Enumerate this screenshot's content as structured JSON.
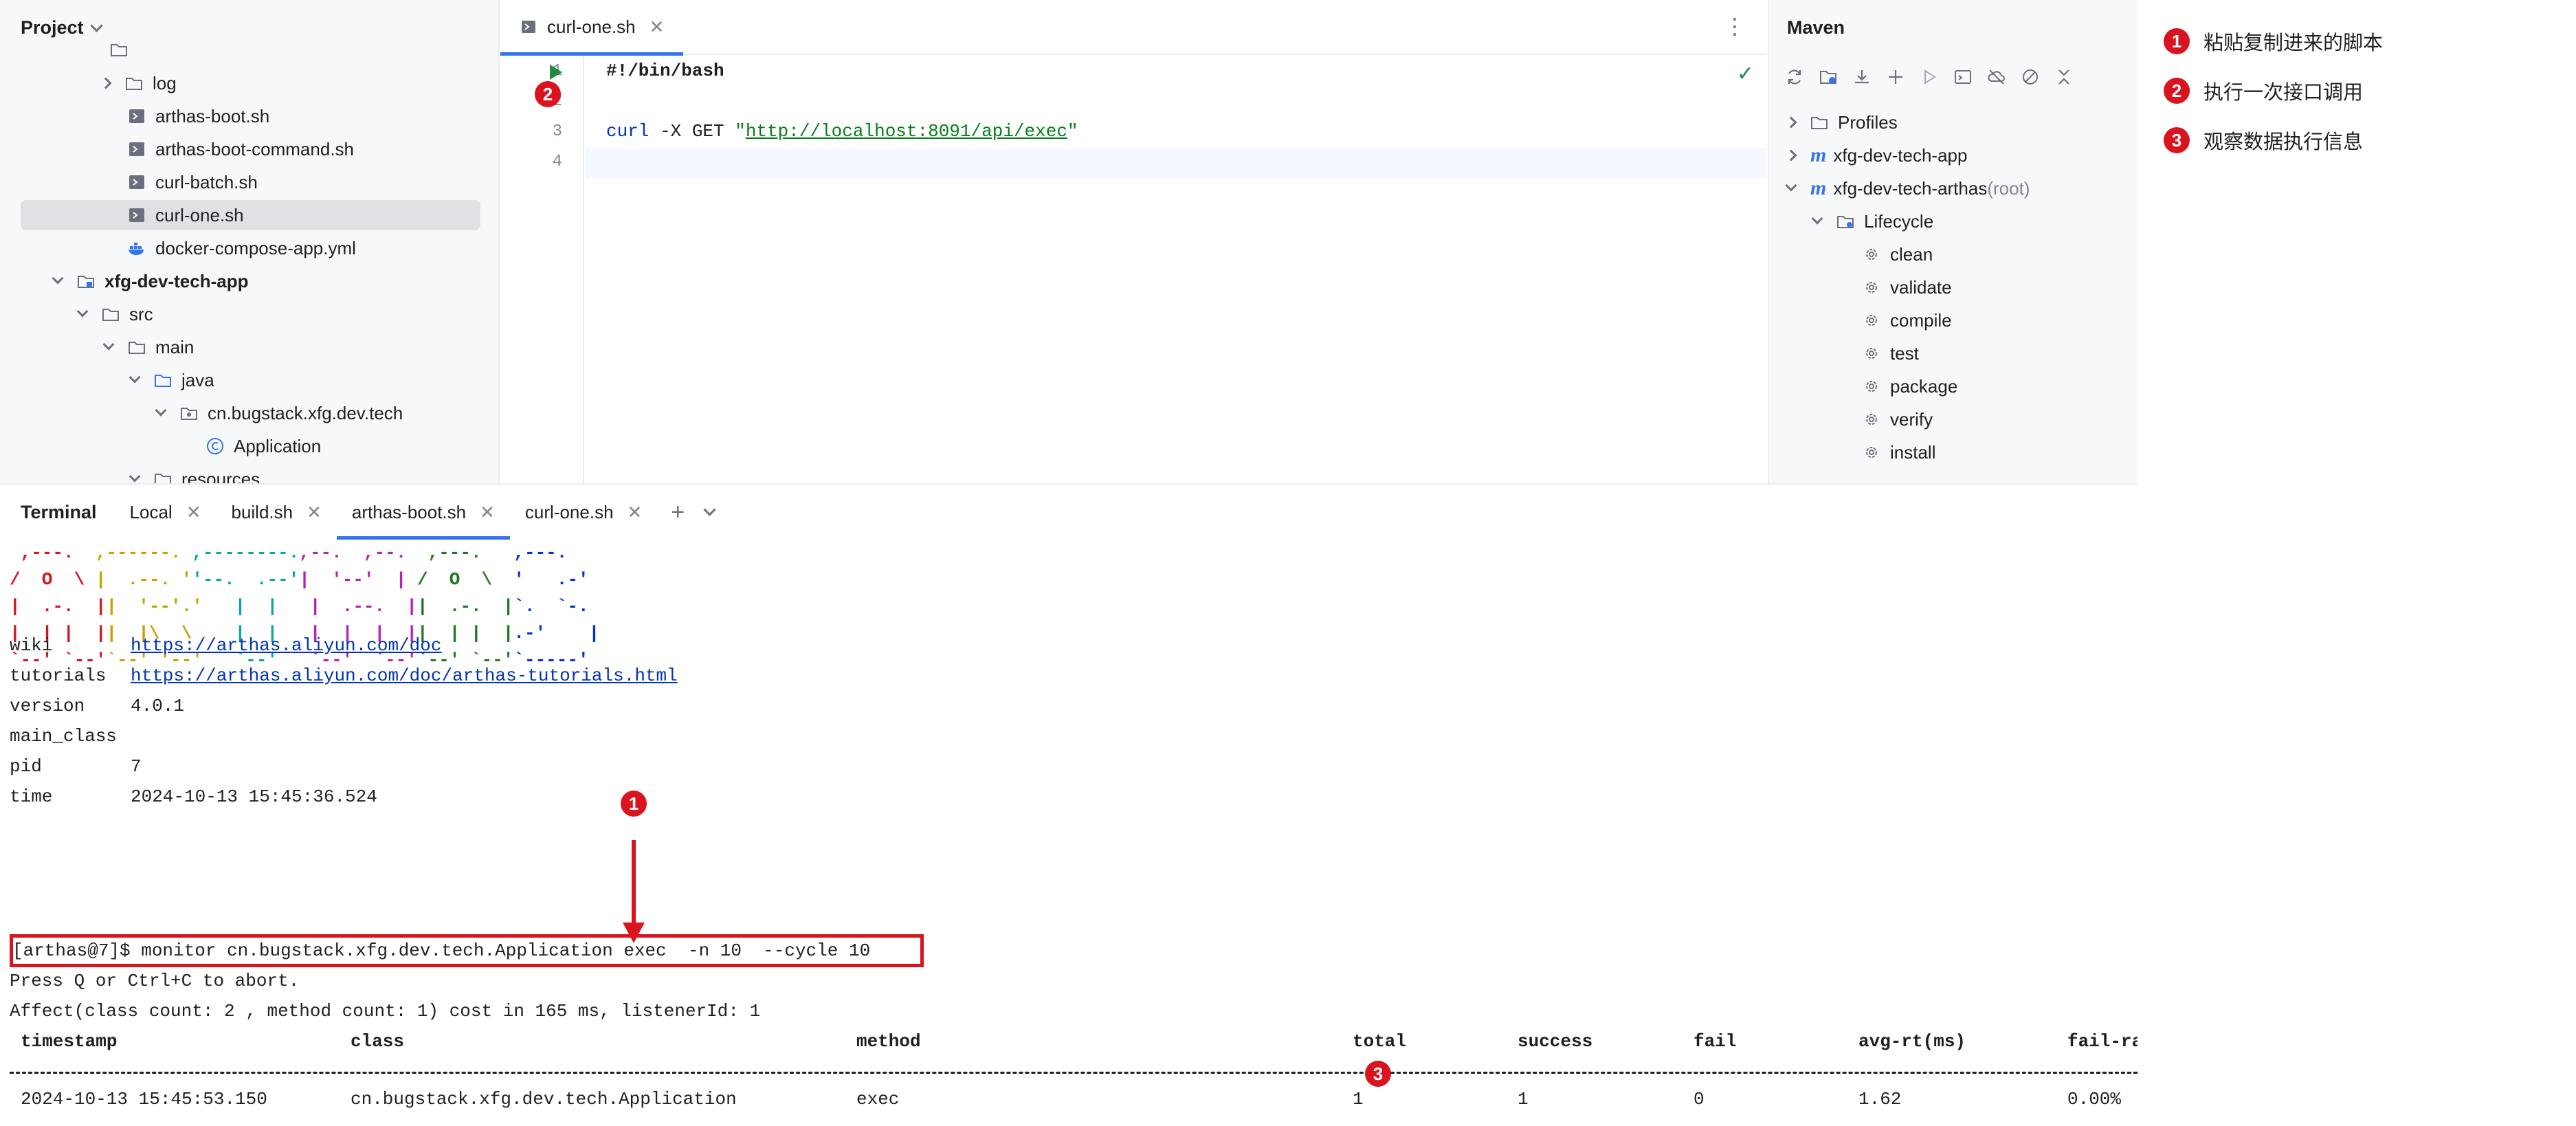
{
  "project": {
    "title": "Project",
    "items": [
      {
        "label": "log",
        "kind": "folder",
        "expanded": false
      },
      {
        "label": "arthas-boot.sh",
        "kind": "shell"
      },
      {
        "label": "arthas-boot-command.sh",
        "kind": "shell"
      },
      {
        "label": "curl-batch.sh",
        "kind": "shell"
      },
      {
        "label": "curl-one.sh",
        "kind": "shell",
        "selected": true
      },
      {
        "label": "docker-compose-app.yml",
        "kind": "docker"
      },
      {
        "label": "xfg-dev-tech-app",
        "kind": "module",
        "expanded": true
      },
      {
        "label": "src",
        "kind": "folder",
        "expanded": true
      },
      {
        "label": "main",
        "kind": "folder",
        "expanded": true
      },
      {
        "label": "java",
        "kind": "source-folder",
        "expanded": true
      },
      {
        "label": "cn.bugstack.xfg.dev.tech",
        "kind": "package",
        "expanded": true
      },
      {
        "label": "Application",
        "kind": "class"
      },
      {
        "label": "resources",
        "kind": "folder",
        "expanded": true
      }
    ]
  },
  "editor": {
    "tab_label": "curl-one.sh",
    "line_numbers": [
      "1",
      "2",
      "3",
      "4"
    ],
    "code": {
      "shebang": "#!/bin/bash",
      "curl_cmd": "curl",
      "curl_args": " -X GET ",
      "quote": "\"",
      "url": "http://localhost:8091/api/exec"
    }
  },
  "maven": {
    "title": "Maven",
    "items": [
      {
        "label": "Profiles",
        "kind": "folder"
      },
      {
        "label": "xfg-dev-tech-app",
        "kind": "project"
      },
      {
        "label": "xfg-dev-tech-arthas",
        "suffix": " (root)",
        "kind": "project"
      },
      {
        "label": "Lifecycle",
        "kind": "lifecycle"
      },
      {
        "label": "clean",
        "kind": "goal"
      },
      {
        "label": "validate",
        "kind": "goal"
      },
      {
        "label": "compile",
        "kind": "goal"
      },
      {
        "label": "test",
        "kind": "goal"
      },
      {
        "label": "package",
        "kind": "goal"
      },
      {
        "label": "verify",
        "kind": "goal"
      },
      {
        "label": "install",
        "kind": "goal"
      }
    ]
  },
  "terminal": {
    "title": "Terminal",
    "tabs": [
      "Local",
      "build.sh",
      "arthas-boot.sh",
      "curl-one.sh"
    ],
    "active_tab": "arthas-boot.sh",
    "info": [
      {
        "key": "wiki",
        "value": "https://arthas.aliyun.com/doc",
        "link": true
      },
      {
        "key": "tutorials",
        "value": "https://arthas.aliyun.com/doc/arthas-tutorials.html",
        "link": true
      },
      {
        "key": "version",
        "value": "4.0.1"
      },
      {
        "key": "main_class",
        "value": ""
      },
      {
        "key": "pid",
        "value": "7"
      },
      {
        "key": "time",
        "value": "2024-10-13 15:45:36.524"
      }
    ],
    "command": "[arthas@7]$ monitor cn.bugstack.xfg.dev.tech.Application exec  -n 10  --cycle 10",
    "abort_msg": "Press Q or Ctrl+C to abort.",
    "affect_msg": "Affect(class count: 2 , method count: 1) cost in 165 ms, listenerId: 1",
    "table_headers": [
      "timestamp",
      "class",
      "method",
      "total",
      "success",
      "fail",
      "avg-rt(ms)",
      "fail-rate"
    ],
    "table_row": [
      "2024-10-13 15:45:53.150",
      "cn.bugstack.xfg.dev.tech.Application",
      "exec",
      "1",
      "1",
      "0",
      "1.62",
      "0.00%"
    ]
  },
  "annotations": {
    "badge_1": "1",
    "badge_2": "2",
    "badge_3": "3"
  },
  "legend": [
    {
      "num": "1",
      "text": "粘贴复制进来的脚本"
    },
    {
      "num": "2",
      "text": "执行一次接口调用"
    },
    {
      "num": "3",
      "text": "观察数据执行信息"
    }
  ],
  "colors": {
    "accent": "#3574f0",
    "annotation_red": "#d9141e",
    "run_green": "#208a3c"
  }
}
